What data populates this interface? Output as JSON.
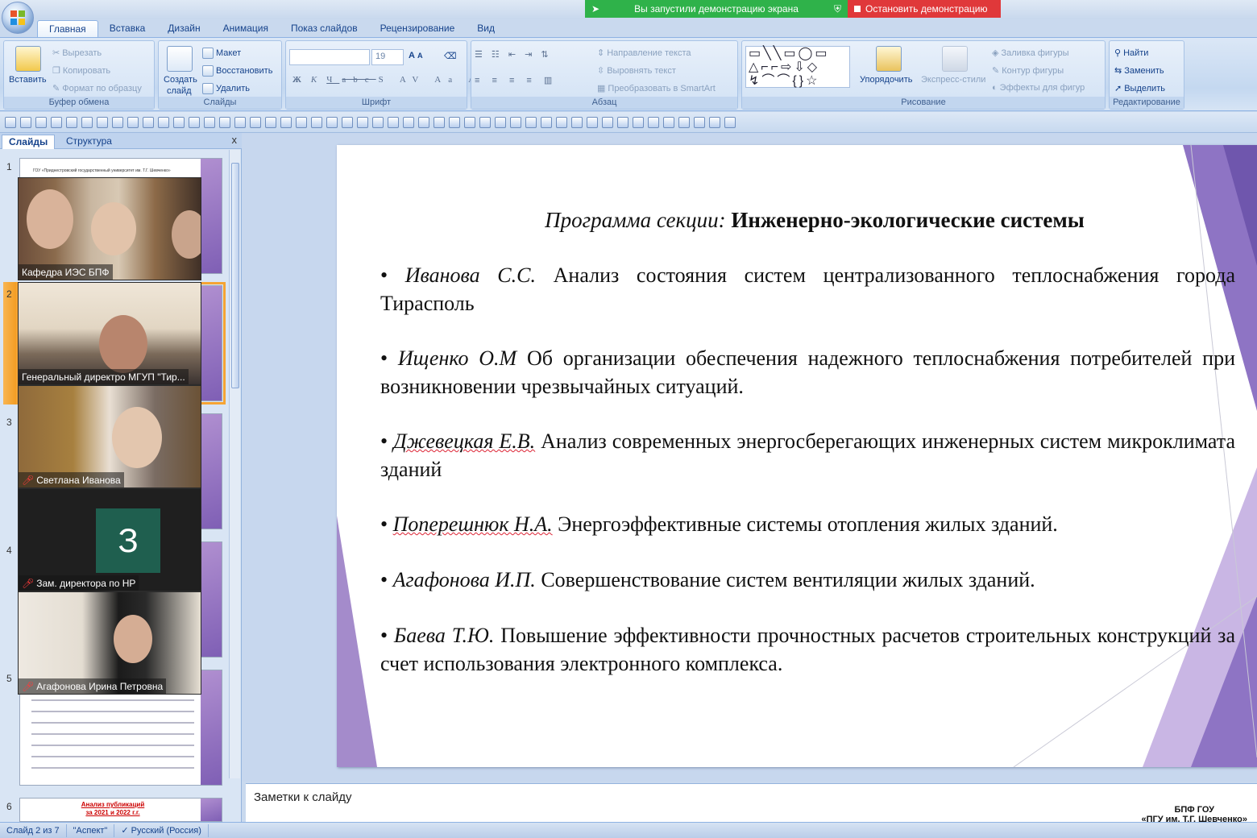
{
  "screen_share": {
    "status_text": "Вы запустили демонстрацию экрана",
    "stop_label": "Остановить демонстрацию"
  },
  "ribbon": {
    "tabs": [
      "Главная",
      "Вставка",
      "Дизайн",
      "Анимация",
      "Показ слайдов",
      "Рецензирование",
      "Вид"
    ],
    "clipboard": {
      "paste": "Вставить",
      "cut": "Вырезать",
      "copy": "Копировать",
      "format": "Формат по образцу",
      "label": "Буфер обмена"
    },
    "slides": {
      "create": "Создать",
      "create2": "слайд",
      "layout": "Макет",
      "restore": "Восстановить",
      "delete": "Удалить",
      "label": "Слайды"
    },
    "font": {
      "size": "19",
      "label": "Шрифт"
    },
    "paragraph": {
      "direction": "Направление текста",
      "align": "Выровнять текст",
      "smartart": "Преобразовать в SmartArt",
      "label": "Абзац"
    },
    "drawing": {
      "arrange": "Упорядочить",
      "quick_styles": "Экспресс-стили",
      "fill": "Заливка фигуры",
      "outline": "Контур фигуры",
      "effects": "Эффекты для фигур",
      "label": "Рисование"
    },
    "editing": {
      "find": "Найти",
      "replace": "Заменить",
      "select": "Выделить",
      "label": "Редактирование"
    }
  },
  "panel": {
    "tab_slides": "Слайды",
    "tab_outline": "Структура",
    "close": "x",
    "numbers": [
      "1",
      "2",
      "3",
      "4",
      "5",
      "6"
    ]
  },
  "thumbnails": {
    "slide1_header": "ГОУ «Приднестровский государственный университет им. Т.Г. Шевченко»",
    "slide6_title": "Анализ публикаций",
    "slide6_sub": "за 2021 и 2022 г.г."
  },
  "participants": [
    {
      "name": "Кафедра ИЭС БПФ",
      "muted": false
    },
    {
      "name": "Генеральный директро МГУП \"Тир...",
      "muted": false
    },
    {
      "name": "Светлана Иванова",
      "muted": true
    },
    {
      "name": "Зам. директора по НР",
      "muted": true,
      "avatar": "З"
    },
    {
      "name": "Агафонова Ирина Петровна",
      "muted": true
    }
  ],
  "slide": {
    "title_italic": "Программа секции: ",
    "title_bold": "Инженерно-экологические системы",
    "entries": [
      {
        "author": "Иванова С.С.",
        "text": " Анализ состояния систем централизованного теплоснабжения города Тирасполь"
      },
      {
        "author": "Ищенко О.М",
        "text": " Об организации обеспечения надежного теплоснабжения потребителей при возникновении  чрезвычайных ситуаций."
      },
      {
        "author": "Джевецкая Е.В.",
        "text": " Анализ современных энергосберегающих инженерных систем микроклимата зданий"
      },
      {
        "author": "Поперешнюк Н.А.",
        "text": " Энергоэффективные системы отопления жилых зданий."
      },
      {
        "author": "Агафонова И.П.",
        "text": " Совершенствование систем вентиляции жилых зданий."
      },
      {
        "author": "Баева Т.Ю.",
        "text": "  Повышение эффективности прочностных расчетов строительных конструкций за счет использования электронного комплекса."
      }
    ]
  },
  "notes": {
    "placeholder": "Заметки к слайду",
    "watermark1": "БПФ ГОУ",
    "watermark2": "«ПГУ им. Т.Г. Шевченко»"
  },
  "status": {
    "slide": "Слайд 2 из 7",
    "theme": "\"Аспект\"",
    "lang": "Русский (Россия)"
  },
  "colors": {
    "share_green": "#2fb24a",
    "stop_red": "#e0383a",
    "selected_slide": "#f39a1e",
    "slide_purple": "#8a6bc0"
  }
}
